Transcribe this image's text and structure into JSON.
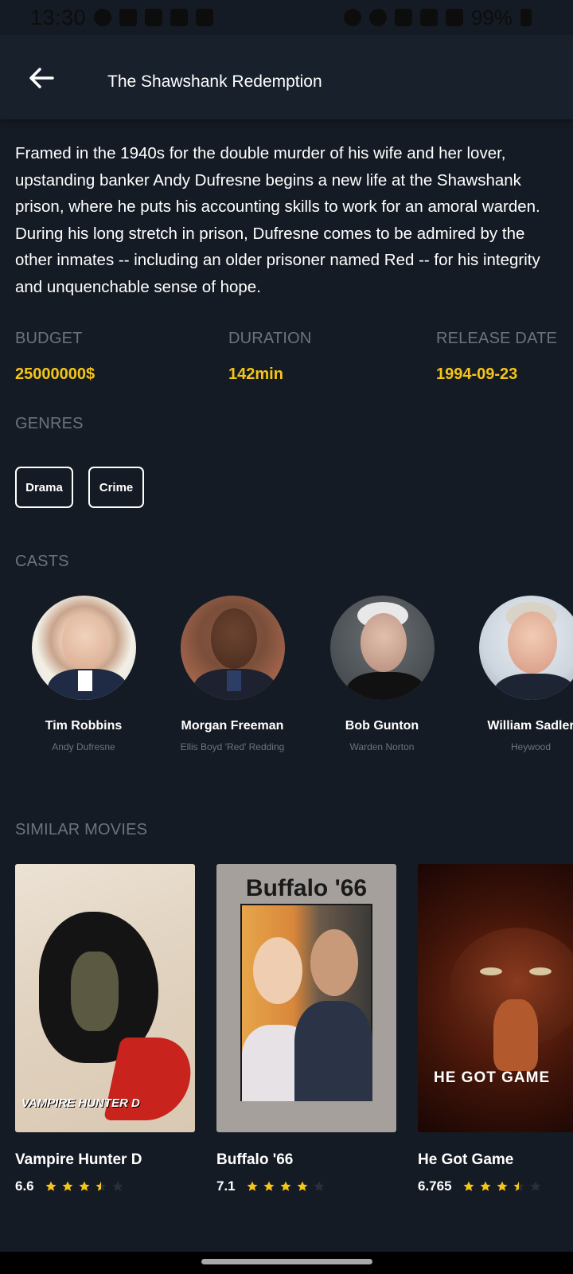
{
  "status_bar": {
    "time": "13:30",
    "battery": "99%"
  },
  "app_bar": {
    "title": "The Shawshank Redemption"
  },
  "overview": "Framed in the 1940s for the double murder of his wife and her lover, upstanding banker Andy Dufresne begins a new life at the Shawshank prison, where he puts his accounting skills to work for an amoral warden. During his long stretch in prison, Dufresne comes to be admired by the other inmates -- including an older prisoner named Red -- for his integrity and unquenchable sense of hope.",
  "info": {
    "budget_label": "BUDGET",
    "budget_value": "25000000$",
    "duration_label": "DURATION",
    "duration_value": "142min",
    "release_label": "RELEASE DATE",
    "release_value": "1994-09-23"
  },
  "genres": {
    "label": "GENRES",
    "items": [
      "Drama",
      "Crime"
    ]
  },
  "casts": {
    "label": "CASTS",
    "items": [
      {
        "name": "Tim Robbins",
        "character": "Andy Dufresne"
      },
      {
        "name": "Morgan Freeman",
        "character": "Ellis Boyd 'Red' Redding"
      },
      {
        "name": "Bob Gunton",
        "character": "Warden Norton"
      },
      {
        "name": "William Sadler",
        "character": "Heywood"
      }
    ]
  },
  "similar": {
    "label": "SIMILAR MOVIES",
    "items": [
      {
        "title": "Vampire Hunter D",
        "rating": "6.6",
        "stars": 3.5,
        "poster_text": "VAMPIRE HUNTER D"
      },
      {
        "title": "Buffalo '66",
        "rating": "7.1",
        "stars": 4,
        "poster_text": "Buffalo '66"
      },
      {
        "title": "He Got Game",
        "rating": "6.765",
        "stars": 3.5,
        "poster_text": "HE GOT GAME"
      }
    ]
  },
  "colors": {
    "background": "#151b24",
    "accent": "#f5c518",
    "muted": "#6b7380"
  }
}
